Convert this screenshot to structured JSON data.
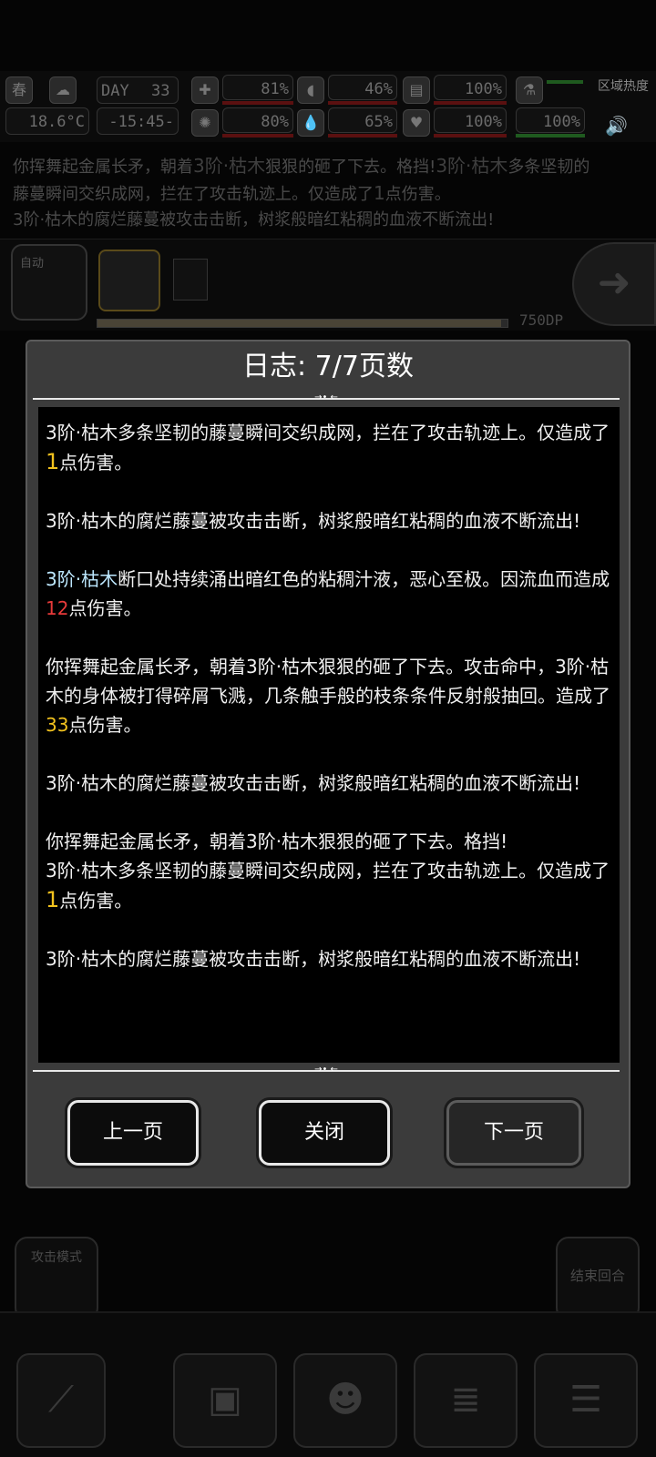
{
  "status": {
    "season": "春",
    "temperature": "18.6°C",
    "day_label": "DAY",
    "day_value": "33",
    "time": "-15:45-",
    "health_pct": "81%",
    "stomach_pct": "46%",
    "stat3_pct": "100%",
    "brain_pct": "80%",
    "water_pct": "65%",
    "heart_pct": "100%",
    "stamina_pct": "100%",
    "area_label": "区域热度"
  },
  "background_log": {
    "line1_a": "你挥舞起金属长矛，朝着",
    "line1_b": "3阶·枯木",
    "line1_c": "狠狠的砸了下去。格挡!",
    "line1_d": "3阶·枯木",
    "line1_e": "多条坚韧的",
    "line2_a": "藤蔓瞬间交织成网，拦在了攻击轨迹上。仅造成了",
    "line2_b": "1",
    "line2_c": "点伤害。",
    "line3": "3阶·枯木的腐烂藤蔓被攻击击断，树浆般暗红粘稠的血液不断流出!"
  },
  "action_row": {
    "auto_label": "自动",
    "cdp_text": "750DP",
    "progress_fraction": 0.985
  },
  "bottom": {
    "attack_mode_label": "攻击模式",
    "end_turn_label": "结束回合"
  },
  "dialog": {
    "title": "日志: 7/7页数",
    "entries": [
      {
        "parts": [
          {
            "text": "3阶·枯木多条坚韧的藤蔓瞬间交织成网，拦在了攻击轨迹上。仅造成了",
            "style": "normal"
          },
          {
            "text": "1",
            "style": "yellow-big"
          },
          {
            "text": "点伤害。",
            "style": "normal"
          }
        ]
      },
      {
        "parts": [
          {
            "text": "3阶·枯木的腐烂藤蔓被攻击击断，树浆般暗红粘稠的血液不断流出!",
            "style": "normal"
          }
        ]
      },
      {
        "parts": [
          {
            "text": "3阶·枯木",
            "style": "blue"
          },
          {
            "text": "断口处持续涌出暗红色的粘稠汁液，恶心至极。因流血而造成",
            "style": "normal"
          },
          {
            "text": "12",
            "style": "red"
          },
          {
            "text": "点伤害。",
            "style": "normal"
          }
        ]
      },
      {
        "parts": [
          {
            "text": "你挥舞起金属长矛，朝着3阶·枯木狠狠的砸了下去。攻击命中，3阶·枯木的身体被打得碎屑飞溅，几条触手般的枝条条件反射般抽回。造成了",
            "style": "normal"
          },
          {
            "text": "33",
            "style": "yellow"
          },
          {
            "text": "点伤害。",
            "style": "normal"
          }
        ]
      },
      {
        "parts": [
          {
            "text": "3阶·枯木的腐烂藤蔓被攻击击断，树浆般暗红粘稠的血液不断流出!",
            "style": "normal"
          }
        ]
      },
      {
        "parts": [
          {
            "text": "你挥舞起金属长矛，朝着3阶·枯木狠狠的砸了下去。格挡!",
            "style": "normal"
          },
          {
            "text": "\n",
            "style": "break"
          },
          {
            "text": "3阶·枯木多条坚韧的藤蔓瞬间交织成网，拦在了攻击轨迹上。仅造成了",
            "style": "normal"
          },
          {
            "text": "1",
            "style": "yellow-big"
          },
          {
            "text": "点伤害。",
            "style": "normal"
          }
        ]
      },
      {
        "parts": [
          {
            "text": "3阶·枯木的腐烂藤蔓被攻击击断，树浆般暗红粘稠的血液不断流出!",
            "style": "normal"
          }
        ]
      }
    ],
    "buttons": {
      "prev": "上一页",
      "close": "关闭",
      "next": "下一页"
    }
  },
  "colors": {
    "number_yellow": "#f2c21e",
    "number_red": "#e83a3a",
    "name_blue": "#bde8ff",
    "dialog_bg": "#3b3b3b"
  }
}
